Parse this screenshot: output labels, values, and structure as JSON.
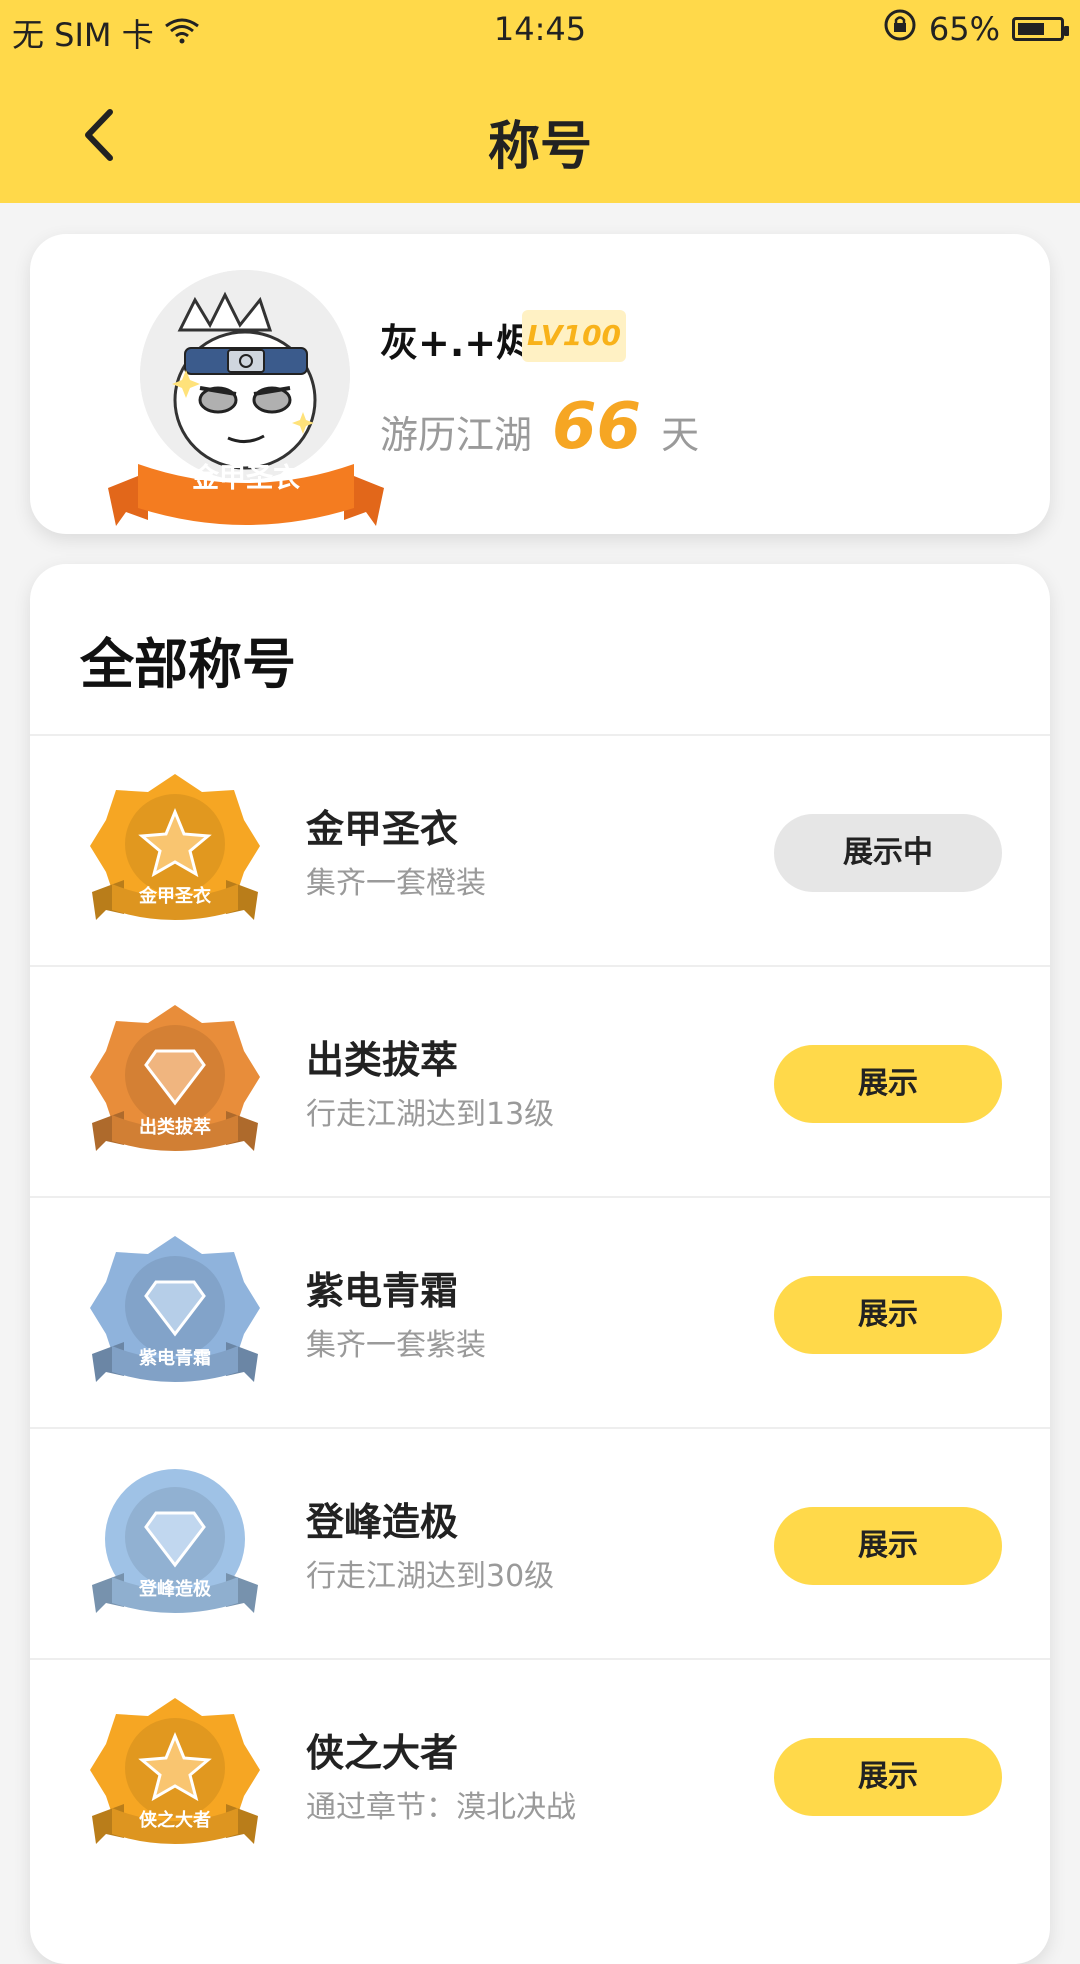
{
  "status_bar": {
    "carrier": "无 SIM 卡",
    "time": "14:45",
    "battery_percent": "65%",
    "battery_level": 0.65
  },
  "nav": {
    "title": "称号",
    "back_icon": "chevron-left-icon"
  },
  "profile": {
    "name": "灰+.+烬",
    "level": "LV100",
    "journey_label": "游历江湖",
    "journey_days": "66",
    "journey_unit": "天",
    "current_title": "金甲圣衣"
  },
  "titles_section": {
    "heading": "全部称号",
    "items": [
      {
        "name": "金甲圣衣",
        "desc": "集齐一套橙装",
        "button": "展示中",
        "active": true,
        "medal_label": "金甲圣衣",
        "medal_color": "#f6a623"
      },
      {
        "name": "出类拔萃",
        "desc": "行走江湖达到13级",
        "button": "展示",
        "active": false,
        "medal_label": "出类拔萃",
        "medal_color": "#e88d3a"
      },
      {
        "name": "紫电青霜",
        "desc": "集齐一套紫装",
        "button": "展示",
        "active": false,
        "medal_label": "紫电青霜",
        "medal_color": "#8fb3dc"
      },
      {
        "name": "登峰造极",
        "desc": "行走江湖达到30级",
        "button": "展示",
        "active": false,
        "medal_label": "登峰造极",
        "medal_color": "#9fc2e6"
      },
      {
        "name": "侠之大者",
        "desc": "通过章节：漠北决战",
        "button": "展示",
        "active": false,
        "medal_label": "侠之大者",
        "medal_color": "#f6a623"
      }
    ]
  },
  "colors": {
    "brand_yellow": "#ffd94a",
    "accent_orange": "#f6a623",
    "muted_text": "#9a9a9a"
  }
}
